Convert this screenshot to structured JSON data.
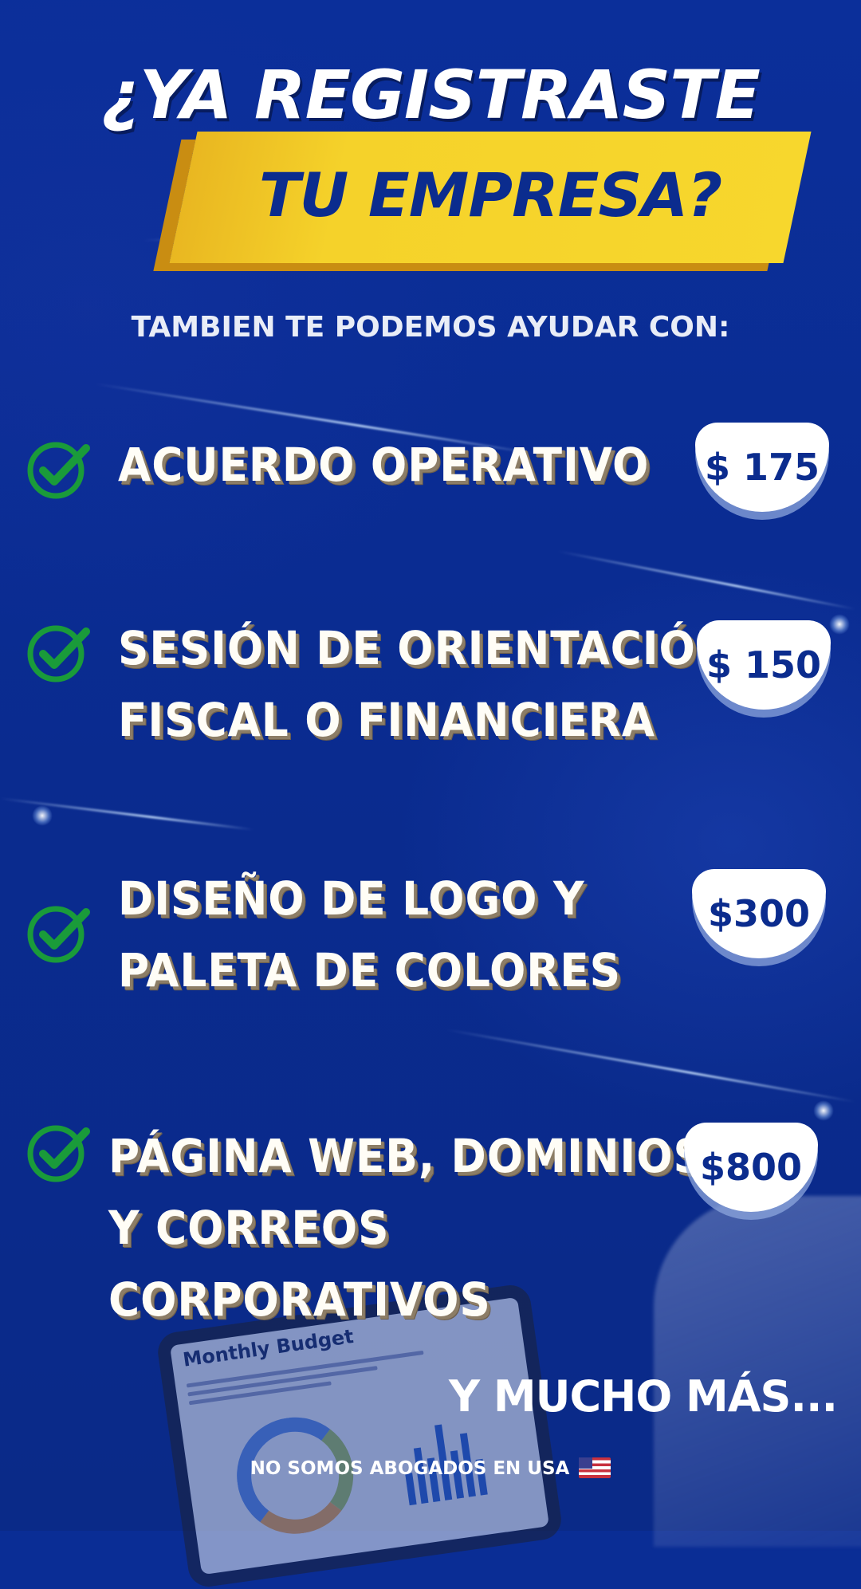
{
  "headline": {
    "line1": "¿YA REGISTRASTE",
    "line2": "TU EMPRESA?"
  },
  "subtitle": "TAMBIEN TE PODEMOS AYUDAR CON:",
  "services": [
    {
      "lines": [
        "ACUERDO OPERATIVO"
      ],
      "price": "$ 175"
    },
    {
      "lines": [
        "SESIÓN DE ORIENTACIÓN",
        "FISCAL O FINANCIERA"
      ],
      "price": "$ 150"
    },
    {
      "lines": [
        "DISEÑO DE LOGO Y",
        "PALETA DE COLORES"
      ],
      "price": "$300"
    },
    {
      "lines": [
        "PÁGINA WEB, DOMINIOS",
        "Y CORREOS",
        "CORPORATIVOS"
      ],
      "price": "$800"
    }
  ],
  "tablet": {
    "title": "Monthly Budget"
  },
  "more": "Y MUCHO MÁS...",
  "disclaimer": "NO SOMOS ABOGADOS EN USA",
  "icons": {
    "check": "check-icon",
    "flag": "us-flag-icon"
  },
  "colors": {
    "background": "#0a2d95",
    "accent": "#f7d72d",
    "check": "#1a9b3a",
    "price_text": "#0b2c8e"
  }
}
